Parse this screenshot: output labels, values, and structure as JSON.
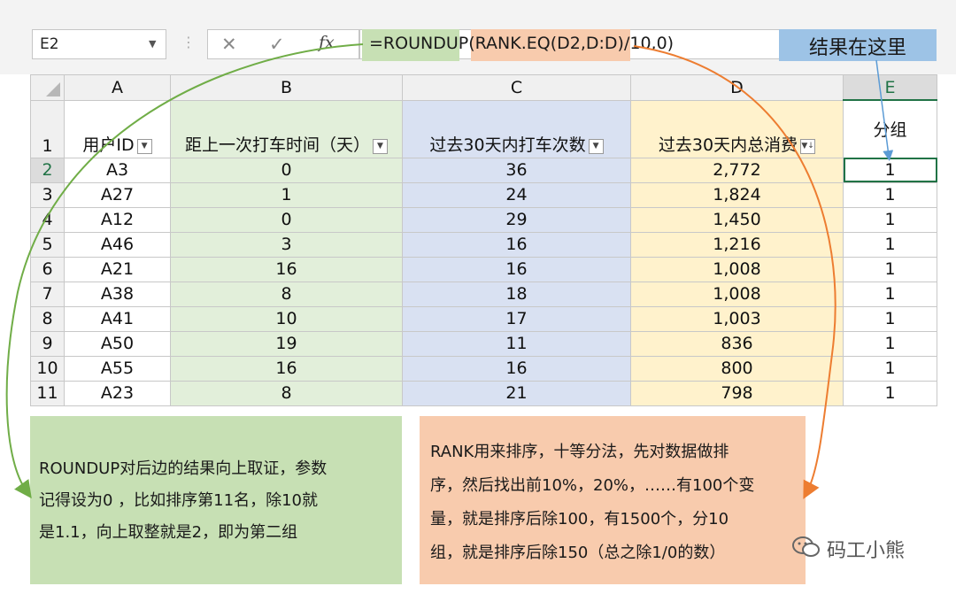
{
  "name_box": "E2",
  "formula": {
    "part1": "=ROUNDUP(",
    "part2": "RANK.EQ(D2,D:D)/10",
    "part3": ",0)"
  },
  "result_callout": "结果在这里",
  "columns": [
    "A",
    "B",
    "C",
    "D",
    "E"
  ],
  "headers": [
    "用户ID",
    "距上一次打车时间（天）",
    "过去30天内打车次数",
    "过去30天内总消费",
    "分组"
  ],
  "rows": [
    {
      "n": "2",
      "cells": [
        "A3",
        "0",
        "36",
        "2,772",
        "1"
      ]
    },
    {
      "n": "3",
      "cells": [
        "A27",
        "1",
        "24",
        "1,824",
        "1"
      ]
    },
    {
      "n": "4",
      "cells": [
        "A12",
        "0",
        "29",
        "1,450",
        "1"
      ]
    },
    {
      "n": "5",
      "cells": [
        "A46",
        "3",
        "16",
        "1,216",
        "1"
      ]
    },
    {
      "n": "6",
      "cells": [
        "A21",
        "16",
        "16",
        "1,008",
        "1"
      ]
    },
    {
      "n": "7",
      "cells": [
        "A38",
        "8",
        "18",
        "1,008",
        "1"
      ]
    },
    {
      "n": "8",
      "cells": [
        "A41",
        "10",
        "17",
        "1,003",
        "1"
      ]
    },
    {
      "n": "9",
      "cells": [
        "A50",
        "19",
        "11",
        "836",
        "1"
      ]
    },
    {
      "n": "10",
      "cells": [
        "A55",
        "16",
        "16",
        "800",
        "1"
      ]
    },
    {
      "n": "11",
      "cells": [
        "A23",
        "8",
        "21",
        "798",
        "1"
      ]
    }
  ],
  "header_row_num": "1",
  "note_left": [
    "ROUNDUP对后边的结果向上取证，参数",
    "记得设为0 ，比如排序第11名，除10就",
    "是1.1，向上取整就是2，即为第二组"
  ],
  "note_right": [
    "RANK用来排序，十等分法，先对数据做排",
    "序，然后找出前10%，20%，……有100个变",
    "量，就是排序后除100，有1500个，分10",
    "组，就是排序后除150（总之除1/0的数）"
  ],
  "watermark": "码工小熊",
  "colors": {
    "green_note": "#c7e0b4",
    "orange_note": "#f8cbad",
    "blue_callout": "#9dc3e6",
    "green_arrow": "#70ad47",
    "orange_arrow": "#ed7d31",
    "blue_arrow": "#5b9bd5"
  }
}
